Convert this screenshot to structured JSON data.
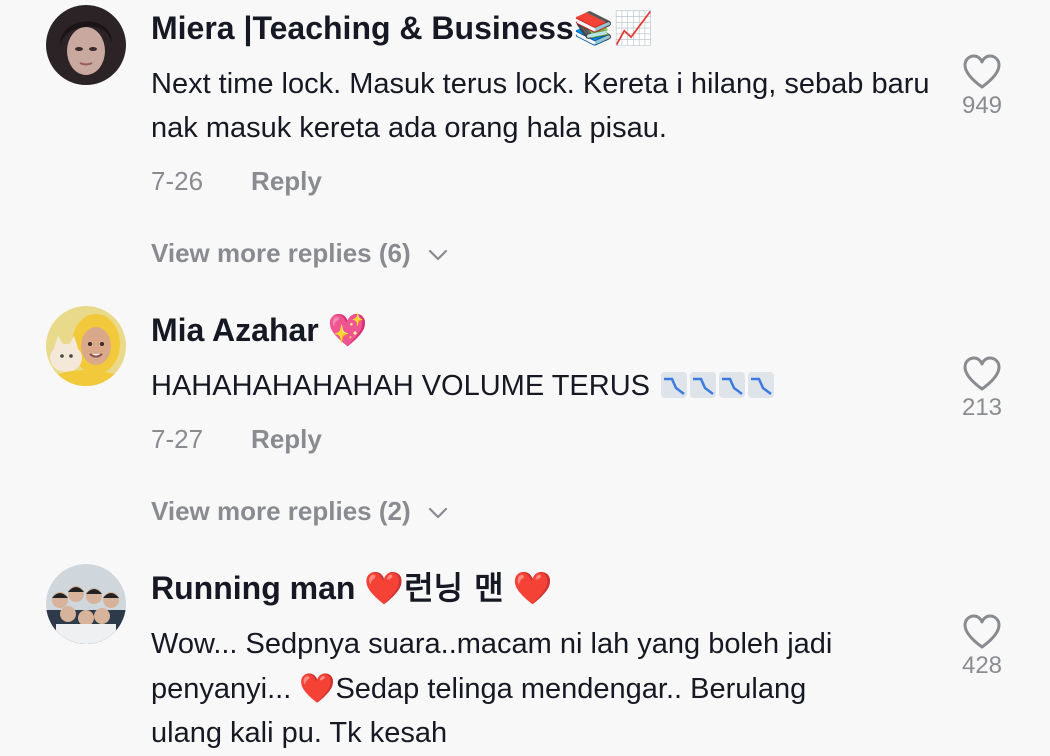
{
  "comments": [
    {
      "username": "Miera |Teaching & Business",
      "username_emoji": "📚📈",
      "text": "Next time lock. Masuk terus lock. Kereta i hilang, sebab baru nak masuk kereta ada orang hala pisau.",
      "date": "7-26",
      "reply_label": "Reply",
      "like_count": "949",
      "view_more": "View more replies (6)",
      "avatar": "profile-photo-woman-dark-hair"
    },
    {
      "username": "Mia Azahar",
      "username_emoji": "💖",
      "text": "HAHAHAHAHAHAH VOLUME TERUS",
      "text_emoji": "📉📉📉📉",
      "date": "7-27",
      "reply_label": "Reply",
      "like_count": "213",
      "view_more": "View more replies (2)",
      "avatar": "profile-photo-woman-yellow-hood-with-cat"
    },
    {
      "username": "Running man",
      "username_emoji_1": "❤️",
      "username_suffix": "런닝 맨",
      "username_emoji_2": "❤️",
      "text_line_1": "Wow... Sedpnya suara..macam ni lah yang boleh jadi",
      "text_line_2_a": "penyanyi... ",
      "text_line_2_emoji": "❤️",
      "text_line_2_b": "Sedap telinga mendengar.. Berulang",
      "text_line_3": "ulang kali pu. Tk kesah",
      "like_count": "428",
      "avatar": "group-photo-running-man-cast"
    }
  ],
  "icons": {
    "like": "heart-outline-icon",
    "expand": "chevron-down-icon"
  },
  "colors": {
    "background": "#f8f8f8",
    "primary_text": "#161823",
    "secondary_text": "#8a8b91"
  }
}
